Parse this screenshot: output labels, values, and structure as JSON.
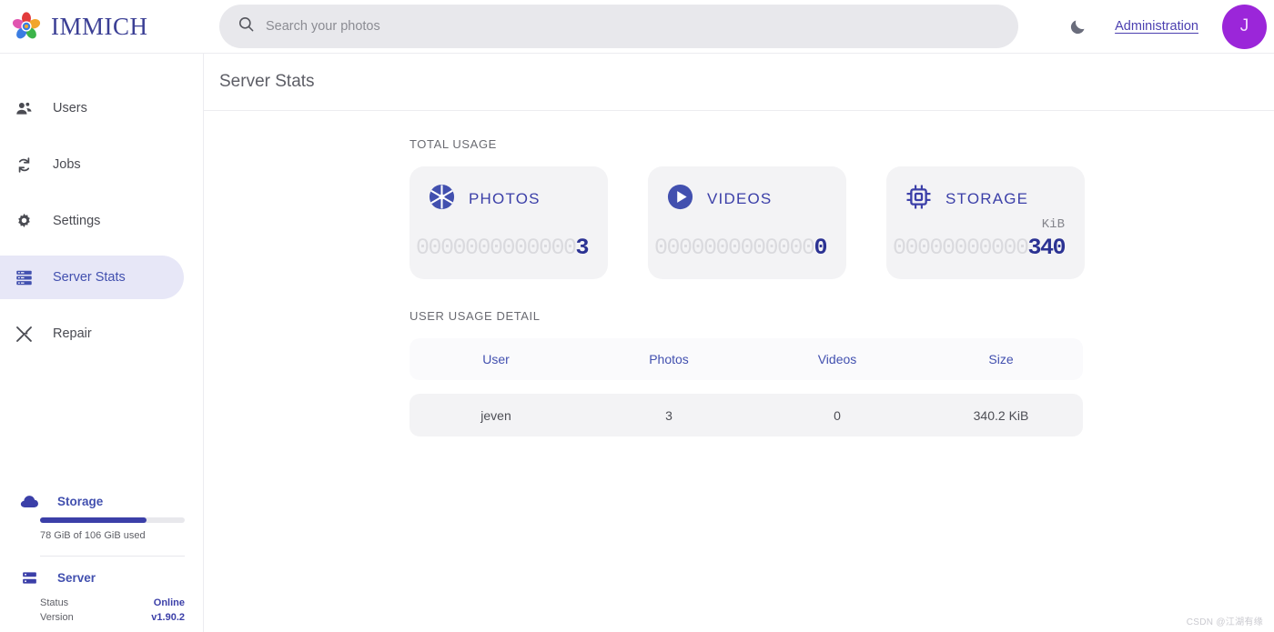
{
  "colors": {
    "accent_indigo": "#3b3fa8",
    "accent_blue": "#4250af",
    "avatar_purple": "#9b26d9",
    "card_bg": "#f3f3f5",
    "muted_zero": "#dadade"
  },
  "topbar": {
    "brand_name": "IMMICH",
    "logo_icon": "immich-flower-logo",
    "search": {
      "icon": "search-icon",
      "placeholder": "Search your photos",
      "value": ""
    },
    "theme_toggle_icon": "moon-icon",
    "admin_link": "Administration",
    "avatar_initial": "J"
  },
  "sidebar": {
    "items": [
      {
        "label": "Users",
        "icon": "users-icon",
        "active": false
      },
      {
        "label": "Jobs",
        "icon": "refresh-cycle-icon",
        "active": false
      },
      {
        "label": "Settings",
        "icon": "gear-icon",
        "active": false
      },
      {
        "label": "Server Stats",
        "icon": "server-stack-icon",
        "active": true
      },
      {
        "label": "Repair",
        "icon": "wrench-screwdriver-icon",
        "active": false
      }
    ],
    "storage": {
      "icon": "cloud-icon",
      "title": "Storage",
      "used_percent": 73.6,
      "text": "78 GiB of 106 GiB used"
    },
    "server": {
      "icon": "server-stack-icon",
      "title": "Server",
      "rows": [
        {
          "key": "Status",
          "value": "Online"
        },
        {
          "key": "Version",
          "value": "v1.90.2"
        }
      ]
    }
  },
  "main": {
    "page_title": "Server Stats",
    "total_usage_label": "TOTAL USAGE",
    "cards": [
      {
        "title": "PHOTOS",
        "icon": "aperture-icon",
        "unit": "",
        "padding_zeros": "0000000000000",
        "value": "3"
      },
      {
        "title": "VIDEOS",
        "icon": "play-circle-icon",
        "unit": "",
        "padding_zeros": "0000000000000",
        "value": "0"
      },
      {
        "title": "STORAGE",
        "icon": "chip-icon",
        "unit": "KiB",
        "padding_zeros": "00000000000",
        "value": "340"
      }
    ],
    "user_usage_label": "USER USAGE DETAIL",
    "table": {
      "columns": [
        "User",
        "Photos",
        "Videos",
        "Size"
      ],
      "rows": [
        {
          "user": "jeven",
          "photos": "3",
          "videos": "0",
          "size": "340.2 KiB"
        }
      ]
    }
  },
  "watermark": "CSDN @江湖有缘"
}
